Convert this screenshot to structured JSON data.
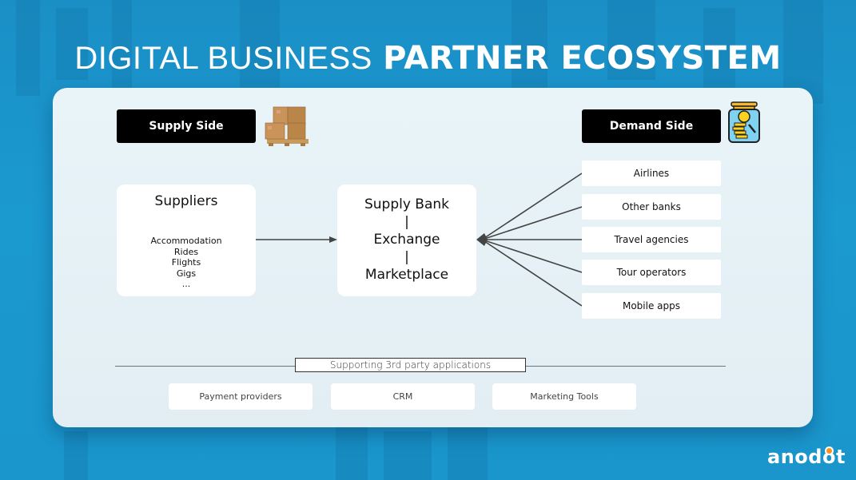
{
  "title": {
    "light": "DIGITAL BUSINESS",
    "bold": "PARTNER ECOSYSTEM"
  },
  "supply": {
    "label": "Supply Side",
    "icon": "cardboard-boxes-on-pallet-icon"
  },
  "demand": {
    "label": "Demand Side",
    "icon": "coin-jar-icon",
    "items": [
      "Airlines",
      "Other banks",
      "Travel agencies",
      "Tour operators",
      "Mobile apps"
    ]
  },
  "suppliers": {
    "heading": "Suppliers",
    "items": [
      "Accommodation",
      "Rides",
      "Flights",
      "Gigs",
      "..."
    ]
  },
  "hub": {
    "lines": [
      "Supply Bank",
      "|",
      "Exchange",
      "|",
      "Marketplace"
    ]
  },
  "support": {
    "label": "Supporting 3rd party applications",
    "items": [
      "Payment providers",
      "CRM",
      "Marketing Tools"
    ]
  },
  "brand": {
    "logo_prefix": "anod",
    "logo_suffix": "t",
    "accent": "#f7931e"
  },
  "colors": {
    "background": "#1a96cc",
    "panel": "#e6f1f6",
    "button": "#000000",
    "connector": "#444444"
  }
}
